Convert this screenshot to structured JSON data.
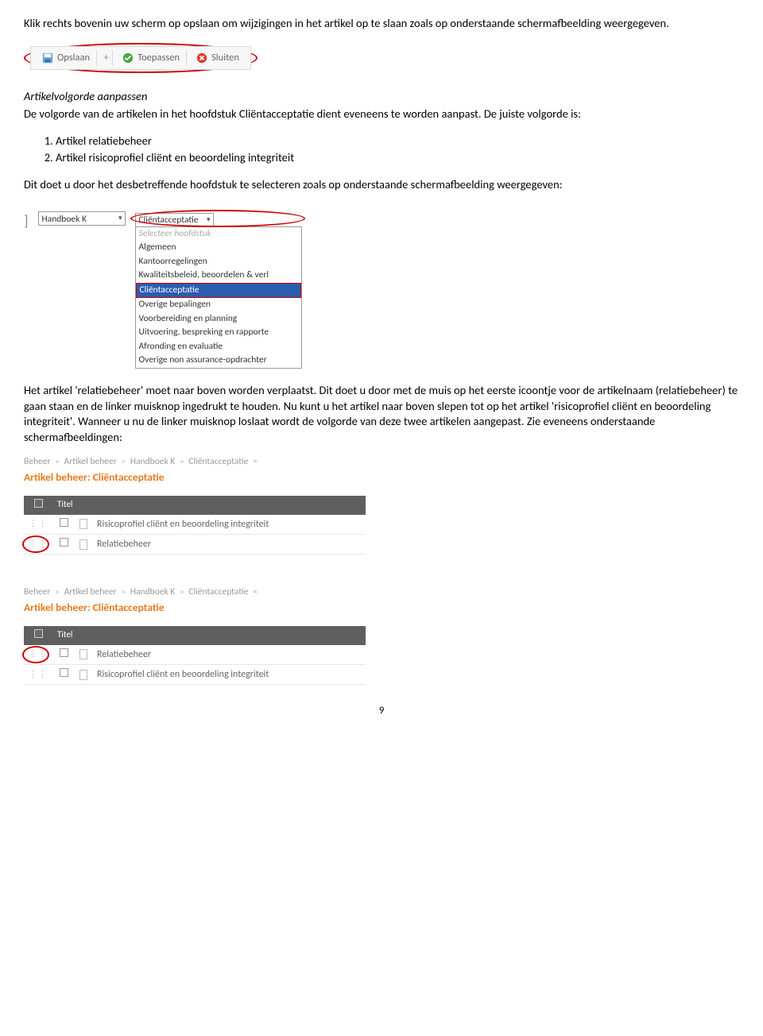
{
  "para1": "Klik rechts bovenin uw scherm op opslaan om wijzigingen in het artikel op te slaan zoals op onderstaande schermafbeelding weergegeven.",
  "toolbar": {
    "save": "Opslaan",
    "plus": "+",
    "apply": "Toepassen",
    "close": "Sluiten"
  },
  "section2_heading": "Artikelvolgorde aanpassen",
  "section2_body": "De volgorde van de artikelen in het hoofdstuk Cliëntacceptatie dient eveneens te worden aanpast. De juiste volgorde is:",
  "ol": [
    "Artikel relatiebeheer",
    "Artikel risicoprofiel cliënt en beoordeling integriteit"
  ],
  "para3": "Dit doet u door het desbetreffende hoofdstuk te selecteren zoals op onderstaande schermafbeelding weergegeven:",
  "dropdown": {
    "left_select": "Handboek K",
    "main_select": "Cliëntacceptatie",
    "options": [
      "Selecteer hoofdstuk",
      "Algemeen",
      "Kantoorregelingen",
      "Kwaliteitsbeleid, beoordelen & verl",
      "Cliëntacceptatie",
      "Overige bepalingen",
      "Voorbereiding en planning",
      "Uitvoering, bespreking en rapporte",
      "Afronding en evaluatie",
      "Overige non assurance-opdrachter"
    ]
  },
  "para4": "Het artikel 'relatiebeheer' moet naar boven worden verplaatst. Dit doet u door met de muis op het eerste icoontje voor de artikelnaam (relatiebeheer) te gaan staan en de linker muisknop ingedrukt te houden. Nu kunt u het artikel naar boven slepen tot op het artikel 'risicoprofiel cliënt en beoordeling integriteit'. Wanneer u nu de linker muisknop loslaat wordt de volgorde van deze twee artikelen aangepast. Zie eveneens onderstaande schermafbeeldingen:",
  "breadcrumb": {
    "b1": "Beheer",
    "b2": "Artikel beheer",
    "b3": "Handboek K",
    "b4": "Cliëntacceptatie",
    "sep": "»",
    "expand": "≈"
  },
  "list_title": "Artikel beheer: Cliëntacceptatie",
  "table": {
    "th_title": "Titel",
    "rows_a": [
      "Risicoprofiel cliënt en beoordeling integriteit",
      "Relatiebeheer"
    ],
    "rows_b": [
      "Relatiebeheer",
      "Risicoprofiel cliënt en beoordeling integriteit"
    ]
  },
  "page_number": "9"
}
